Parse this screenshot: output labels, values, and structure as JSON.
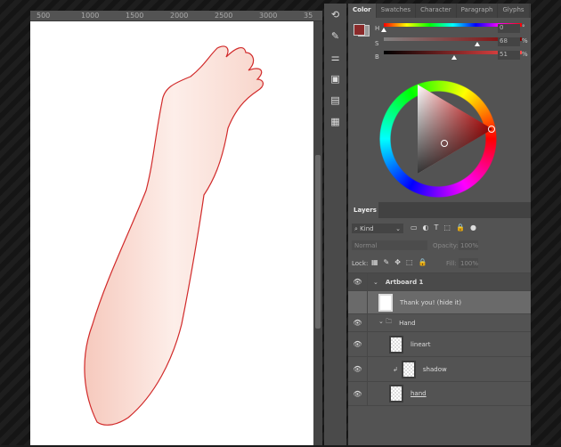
{
  "ruler": {
    "ticks": [
      "500",
      "1000",
      "1500",
      "2000",
      "2500",
      "3000",
      "35"
    ]
  },
  "color_panel": {
    "tabs": [
      "Color",
      "Swatches",
      "Character",
      "Paragraph",
      "Glyphs"
    ],
    "active_tab": "Color",
    "foreground": "#8b2a2a",
    "background": "#9a9a9a",
    "h": {
      "label": "H",
      "value": "0",
      "unit": "°",
      "fraction": 0.0
    },
    "s": {
      "label": "S",
      "value": "68",
      "unit": "%",
      "fraction": 0.68
    },
    "b": {
      "label": "B",
      "value": "51",
      "unit": "%",
      "fraction": 0.51
    }
  },
  "layers_panel": {
    "tab": "Layers",
    "filter": "Kind",
    "blend_mode": "Normal",
    "opacity_label": "Opacity:",
    "opacity": "100%",
    "lock_label": "Lock:",
    "fill_label": "Fill:",
    "fill": "100%",
    "layers": [
      {
        "name": "Artboard 1",
        "type": "artboard",
        "visible": true
      },
      {
        "name": "Thank you! (hide it)",
        "type": "smart-object",
        "visible": false,
        "selected": true
      },
      {
        "name": "Hand",
        "type": "group",
        "visible": true
      },
      {
        "name": "lineart",
        "type": "layer",
        "visible": true
      },
      {
        "name": "shadow",
        "type": "clipped-layer",
        "visible": true
      },
      {
        "name": "hand",
        "type": "layer",
        "visible": true
      }
    ]
  }
}
